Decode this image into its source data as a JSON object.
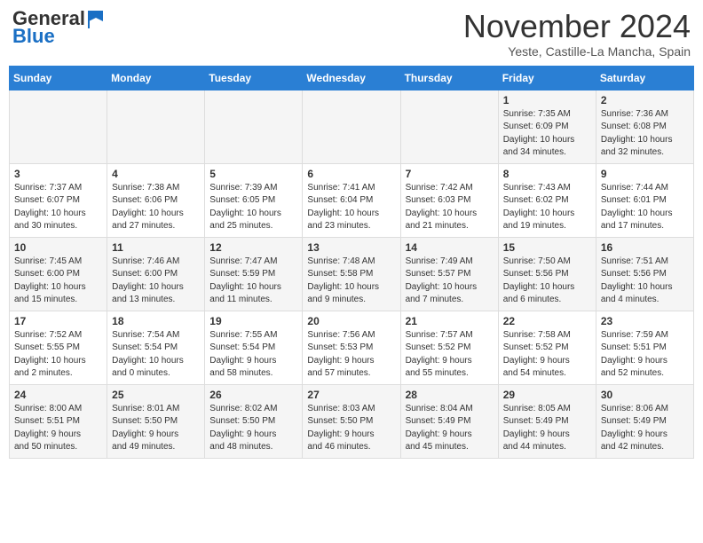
{
  "header": {
    "logo_general": "General",
    "logo_blue": "Blue",
    "month": "November 2024",
    "location": "Yeste, Castille-La Mancha, Spain"
  },
  "weekdays": [
    "Sunday",
    "Monday",
    "Tuesday",
    "Wednesday",
    "Thursday",
    "Friday",
    "Saturday"
  ],
  "weeks": [
    [
      {
        "day": "",
        "info": ""
      },
      {
        "day": "",
        "info": ""
      },
      {
        "day": "",
        "info": ""
      },
      {
        "day": "",
        "info": ""
      },
      {
        "day": "",
        "info": ""
      },
      {
        "day": "1",
        "info": "Sunrise: 7:35 AM\nSunset: 6:09 PM\nDaylight: 10 hours\nand 34 minutes."
      },
      {
        "day": "2",
        "info": "Sunrise: 7:36 AM\nSunset: 6:08 PM\nDaylight: 10 hours\nand 32 minutes."
      }
    ],
    [
      {
        "day": "3",
        "info": "Sunrise: 7:37 AM\nSunset: 6:07 PM\nDaylight: 10 hours\nand 30 minutes."
      },
      {
        "day": "4",
        "info": "Sunrise: 7:38 AM\nSunset: 6:06 PM\nDaylight: 10 hours\nand 27 minutes."
      },
      {
        "day": "5",
        "info": "Sunrise: 7:39 AM\nSunset: 6:05 PM\nDaylight: 10 hours\nand 25 minutes."
      },
      {
        "day": "6",
        "info": "Sunrise: 7:41 AM\nSunset: 6:04 PM\nDaylight: 10 hours\nand 23 minutes."
      },
      {
        "day": "7",
        "info": "Sunrise: 7:42 AM\nSunset: 6:03 PM\nDaylight: 10 hours\nand 21 minutes."
      },
      {
        "day": "8",
        "info": "Sunrise: 7:43 AM\nSunset: 6:02 PM\nDaylight: 10 hours\nand 19 minutes."
      },
      {
        "day": "9",
        "info": "Sunrise: 7:44 AM\nSunset: 6:01 PM\nDaylight: 10 hours\nand 17 minutes."
      }
    ],
    [
      {
        "day": "10",
        "info": "Sunrise: 7:45 AM\nSunset: 6:00 PM\nDaylight: 10 hours\nand 15 minutes."
      },
      {
        "day": "11",
        "info": "Sunrise: 7:46 AM\nSunset: 6:00 PM\nDaylight: 10 hours\nand 13 minutes."
      },
      {
        "day": "12",
        "info": "Sunrise: 7:47 AM\nSunset: 5:59 PM\nDaylight: 10 hours\nand 11 minutes."
      },
      {
        "day": "13",
        "info": "Sunrise: 7:48 AM\nSunset: 5:58 PM\nDaylight: 10 hours\nand 9 minutes."
      },
      {
        "day": "14",
        "info": "Sunrise: 7:49 AM\nSunset: 5:57 PM\nDaylight: 10 hours\nand 7 minutes."
      },
      {
        "day": "15",
        "info": "Sunrise: 7:50 AM\nSunset: 5:56 PM\nDaylight: 10 hours\nand 6 minutes."
      },
      {
        "day": "16",
        "info": "Sunrise: 7:51 AM\nSunset: 5:56 PM\nDaylight: 10 hours\nand 4 minutes."
      }
    ],
    [
      {
        "day": "17",
        "info": "Sunrise: 7:52 AM\nSunset: 5:55 PM\nDaylight: 10 hours\nand 2 minutes."
      },
      {
        "day": "18",
        "info": "Sunrise: 7:54 AM\nSunset: 5:54 PM\nDaylight: 10 hours\nand 0 minutes."
      },
      {
        "day": "19",
        "info": "Sunrise: 7:55 AM\nSunset: 5:54 PM\nDaylight: 9 hours\nand 58 minutes."
      },
      {
        "day": "20",
        "info": "Sunrise: 7:56 AM\nSunset: 5:53 PM\nDaylight: 9 hours\nand 57 minutes."
      },
      {
        "day": "21",
        "info": "Sunrise: 7:57 AM\nSunset: 5:52 PM\nDaylight: 9 hours\nand 55 minutes."
      },
      {
        "day": "22",
        "info": "Sunrise: 7:58 AM\nSunset: 5:52 PM\nDaylight: 9 hours\nand 54 minutes."
      },
      {
        "day": "23",
        "info": "Sunrise: 7:59 AM\nSunset: 5:51 PM\nDaylight: 9 hours\nand 52 minutes."
      }
    ],
    [
      {
        "day": "24",
        "info": "Sunrise: 8:00 AM\nSunset: 5:51 PM\nDaylight: 9 hours\nand 50 minutes."
      },
      {
        "day": "25",
        "info": "Sunrise: 8:01 AM\nSunset: 5:50 PM\nDaylight: 9 hours\nand 49 minutes."
      },
      {
        "day": "26",
        "info": "Sunrise: 8:02 AM\nSunset: 5:50 PM\nDaylight: 9 hours\nand 48 minutes."
      },
      {
        "day": "27",
        "info": "Sunrise: 8:03 AM\nSunset: 5:50 PM\nDaylight: 9 hours\nand 46 minutes."
      },
      {
        "day": "28",
        "info": "Sunrise: 8:04 AM\nSunset: 5:49 PM\nDaylight: 9 hours\nand 45 minutes."
      },
      {
        "day": "29",
        "info": "Sunrise: 8:05 AM\nSunset: 5:49 PM\nDaylight: 9 hours\nand 44 minutes."
      },
      {
        "day": "30",
        "info": "Sunrise: 8:06 AM\nSunset: 5:49 PM\nDaylight: 9 hours\nand 42 minutes."
      }
    ]
  ]
}
